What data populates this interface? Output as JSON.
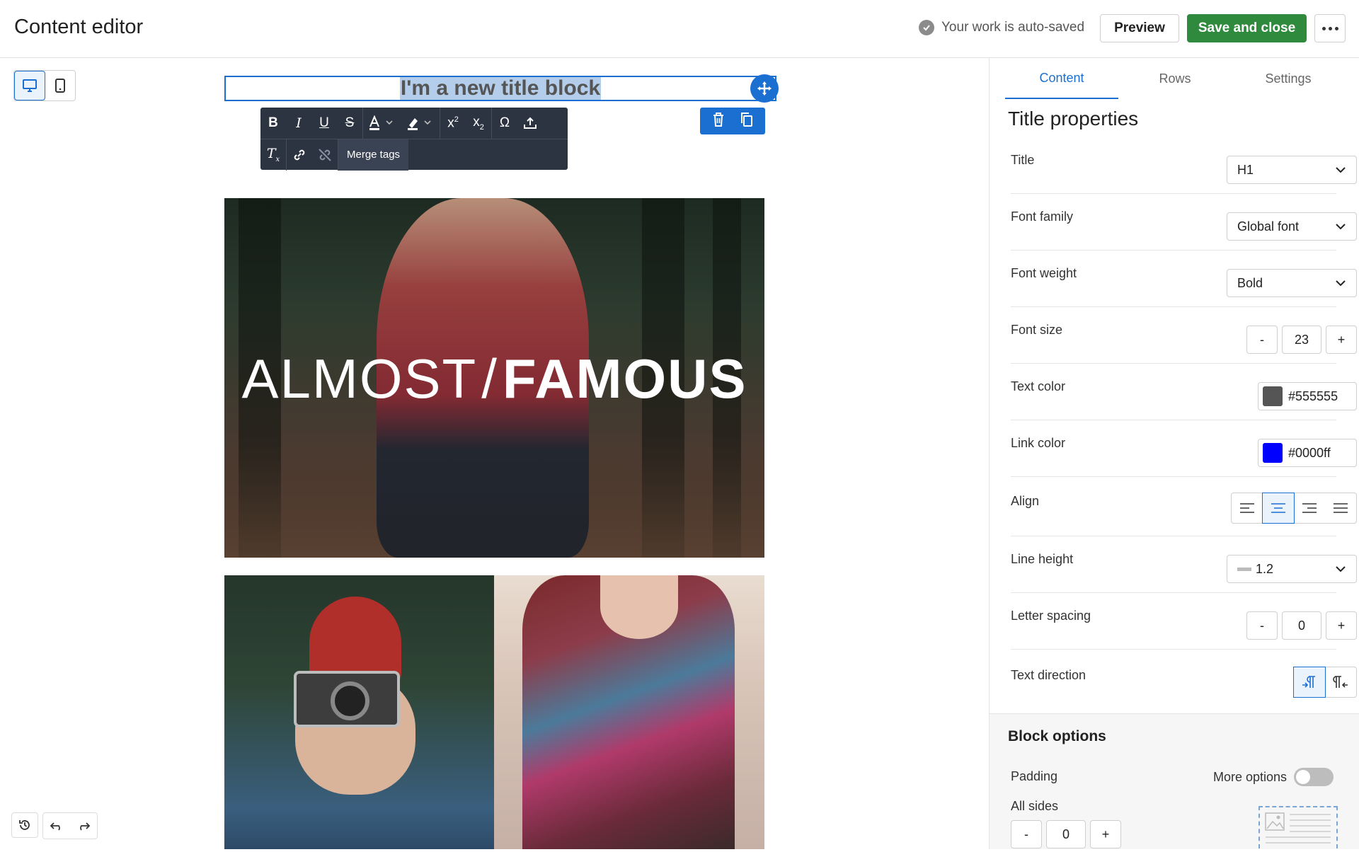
{
  "header": {
    "title": "Content editor",
    "autosave_text": "Your work is auto-saved",
    "preview_label": "Preview",
    "save_label": "Save and close"
  },
  "canvas": {
    "title_block_text": "I'm a new title block",
    "rte": {
      "merge_tags_label": "Merge tags"
    },
    "hero_text_thin": "ALMOST",
    "hero_text_slash": "/",
    "hero_text_bold": "FAMOUS"
  },
  "panel": {
    "tabs": [
      {
        "label": "Content",
        "active": true
      },
      {
        "label": "Rows",
        "active": false
      },
      {
        "label": "Settings",
        "active": false
      }
    ],
    "heading": "Title properties",
    "props": {
      "title": {
        "label": "Title",
        "value": "H1"
      },
      "font_family": {
        "label": "Font family",
        "value": "Global font"
      },
      "font_weight": {
        "label": "Font weight",
        "value": "Bold"
      },
      "font_size": {
        "label": "Font size",
        "value": "23",
        "minus": "-",
        "plus": "+"
      },
      "text_color": {
        "label": "Text color",
        "value": "#555555",
        "swatch": "#555555"
      },
      "link_color": {
        "label": "Link color",
        "value": "#0000ff",
        "swatch": "#0000ff"
      },
      "align": {
        "label": "Align",
        "selected": "center"
      },
      "line_height": {
        "label": "Line height",
        "value": "1.2"
      },
      "letter_spacing": {
        "label": "Letter spacing",
        "value": "0",
        "minus": "-",
        "plus": "+"
      },
      "text_direction": {
        "label": "Text direction",
        "selected": "ltr"
      }
    },
    "block_options": {
      "title": "Block options",
      "padding_label": "Padding",
      "more_options_label": "More options",
      "all_sides_label": "All sides",
      "all_sides_value": "0",
      "minus": "-",
      "plus": "+"
    }
  },
  "colors": {
    "accent": "#1b6fd1",
    "save": "#2f8a3d",
    "toolbar": "#2c3442"
  }
}
